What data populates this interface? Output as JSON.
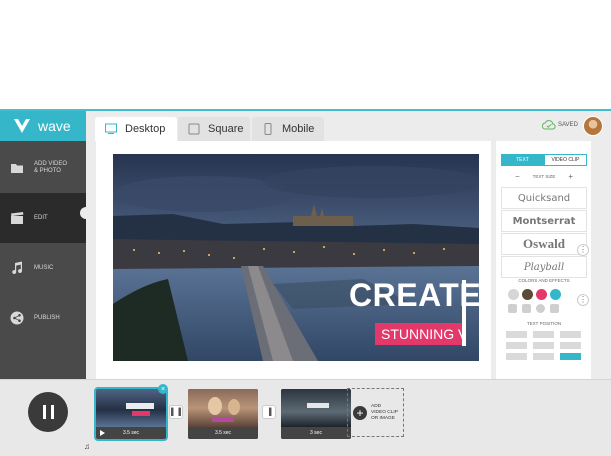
{
  "brand": {
    "name": "wave"
  },
  "sidebar": {
    "items": [
      {
        "label": "ADD VIDEO & PHOTO",
        "icon": "film-folder-icon"
      },
      {
        "label": "EDIT",
        "icon": "clapperboard-icon",
        "active": true
      },
      {
        "label": "MUSIC",
        "icon": "music-note-icon"
      },
      {
        "label": "PUBLISH",
        "icon": "share-icon"
      }
    ]
  },
  "tabs": [
    {
      "label": "Desktop",
      "active": true
    },
    {
      "label": "Square"
    },
    {
      "label": "Mobile"
    }
  ],
  "header": {
    "saved_label": "SAVED"
  },
  "canvas": {
    "headline": "CREATE",
    "subline": "STUNNING VI"
  },
  "panel": {
    "text_tab": "TEXT",
    "video_clip_tab": "VIDEO CLIP",
    "text_size_label": "TEXT SIZE",
    "minus": "−",
    "plus": "+",
    "fonts": [
      "Quicksand",
      "Montserrat",
      "Oswald",
      "Playball"
    ],
    "colors_label": "COLORS AND EFFECTS",
    "text_position_label": "TEXT POSITION",
    "colors": [
      "#d6d6d6",
      "#5a4a36",
      "#e3386a",
      "#35b6c9"
    ]
  },
  "timeline": {
    "clips": [
      {
        "duration": "3.5 sec"
      },
      {
        "duration": "3.5 sec"
      },
      {
        "duration": "3 sec"
      }
    ],
    "add_label_1": "ADD",
    "add_label_2": "VIDEO CLIP",
    "add_label_3": "OR IMAGE",
    "music_glyph": "♫"
  },
  "colors": {
    "accent": "#35b6c9",
    "sidebar": "#4a4a4a",
    "highlight": "#e3386a"
  }
}
